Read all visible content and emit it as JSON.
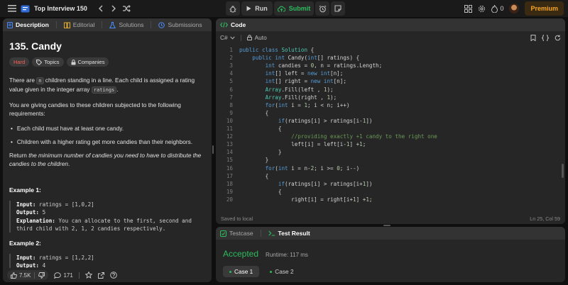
{
  "topbar": {
    "title": "Top Interview 150",
    "run_label": "Run",
    "submit_label": "Submit",
    "streak_count": "0",
    "premium_label": "Premium"
  },
  "description": {
    "tabs": [
      "Description",
      "Editorial",
      "Solutions",
      "Submissions"
    ],
    "title": "135. Candy",
    "difficulty": "Hard",
    "chips": [
      "Topics",
      "Companies"
    ],
    "para1_a": "There are ",
    "para1_code1": "n",
    "para1_b": " children standing in a line. Each child is assigned a rating value given in the integer array ",
    "para1_code2": "ratings",
    "para1_c": ".",
    "para2": "You are giving candies to these children subjected to the following requirements:",
    "bullets": [
      "Each child must have at least one candy.",
      "Children with a higher rating get more candies than their neighbors."
    ],
    "para3_a": "Return ",
    "para3_em": "the minimum number of candies you need to have to distribute the candies to the children",
    "para3_b": ".",
    "example1_title": "Example 1:",
    "example1": {
      "input_label": "Input:",
      "input": " ratings = [1,0,2]",
      "output_label": "Output:",
      "output": " 5",
      "explanation_label": "Explanation:",
      "explanation": " You can allocate to the first, second and third child with 2, 1, 2 candies respectively."
    },
    "example2_title": "Example 2:",
    "example2": {
      "input_label": "Input:",
      "input": " ratings = [1,2,2]",
      "output_label": "Output:",
      "output": " 4"
    },
    "footer": {
      "likes": "7.5K",
      "comments": "171"
    }
  },
  "code": {
    "tab_label": "Code",
    "language": "C#",
    "mode": "Auto",
    "saved_status": "Saved to local",
    "cursor_position": "Ln 25, Col 59",
    "lines": [
      {
        "n": "1",
        "text": "public class Solution {"
      },
      {
        "n": "2",
        "text": "    public int Candy(int[] ratings) {"
      },
      {
        "n": "3",
        "text": "        int candies = 0, n = ratings.Length;"
      },
      {
        "n": "4",
        "text": "        int[] left = new int[n];"
      },
      {
        "n": "5",
        "text": "        int[] right = new int[n];"
      },
      {
        "n": "6",
        "text": "        Array.Fill(left , 1);"
      },
      {
        "n": "7",
        "text": "        Array.Fill(right , 1);"
      },
      {
        "n": "8",
        "text": "        for(int i = 1; i < n; i++)"
      },
      {
        "n": "9",
        "text": "        {"
      },
      {
        "n": "10",
        "text": "            if(ratings[i] > ratings[i-1])"
      },
      {
        "n": "11",
        "text": "            {"
      },
      {
        "n": "12",
        "text": "                //providing exactly +1 candy to the right one"
      },
      {
        "n": "13",
        "text": "                left[i] = left[i-1] +1;"
      },
      {
        "n": "14",
        "text": "            }"
      },
      {
        "n": "15",
        "text": "        }"
      },
      {
        "n": "16",
        "text": "        for(int i = n-2; i >= 0; i--)"
      },
      {
        "n": "17",
        "text": "        {"
      },
      {
        "n": "18",
        "text": "            if(ratings[i] > ratings[i+1])"
      },
      {
        "n": "19",
        "text": "            {"
      },
      {
        "n": "20",
        "text": "                right[i] = right[i+1] +1;"
      }
    ]
  },
  "result": {
    "tabs": [
      "Testcase",
      "Test Result"
    ],
    "status": "Accepted",
    "runtime": "Runtime: 117 ms",
    "cases": [
      "Case 1",
      "Case 2"
    ]
  },
  "colors": {
    "accepted": "#2cbb5d",
    "hard": "#ff5f56",
    "premium": "#f5a623",
    "keyword": "#569cd6",
    "type": "#4ec9b0",
    "comment": "#6a9955",
    "number": "#b5cea8"
  }
}
